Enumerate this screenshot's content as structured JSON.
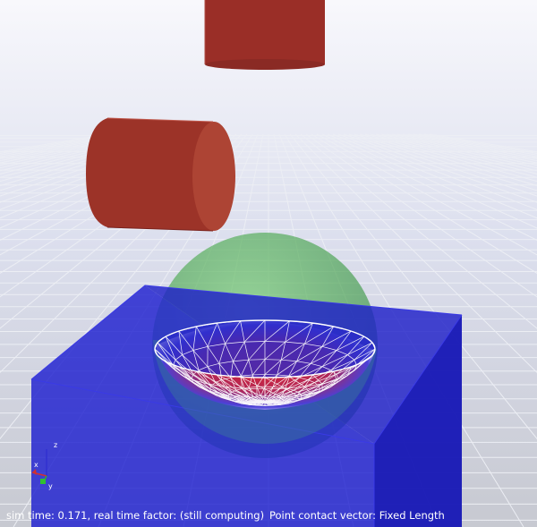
{
  "status_bar": {
    "sim_time": "sim time: 0.171, real time factor: (still computing)",
    "contact_mode": "Point contact vector: Fixed Length"
  },
  "axes_triad": {
    "z_label": "z",
    "x_label": "x",
    "y_label": "y"
  },
  "colors": {
    "sky_top": "#d8dcee",
    "ground": "#c6c8ce",
    "grid_line": "#e2e4ea",
    "cylinder": "#8c2a24",
    "box": "#2a2acb",
    "sphere": "#55b45a",
    "contact_mesh": "#ffffff",
    "pressure_high": "#d8242a",
    "pressure_low": "#ffffff"
  },
  "objects": [
    "upper-cylinder",
    "lower-cylinder",
    "green-sphere",
    "blue-box",
    "hydroelastic-contact-surface"
  ]
}
